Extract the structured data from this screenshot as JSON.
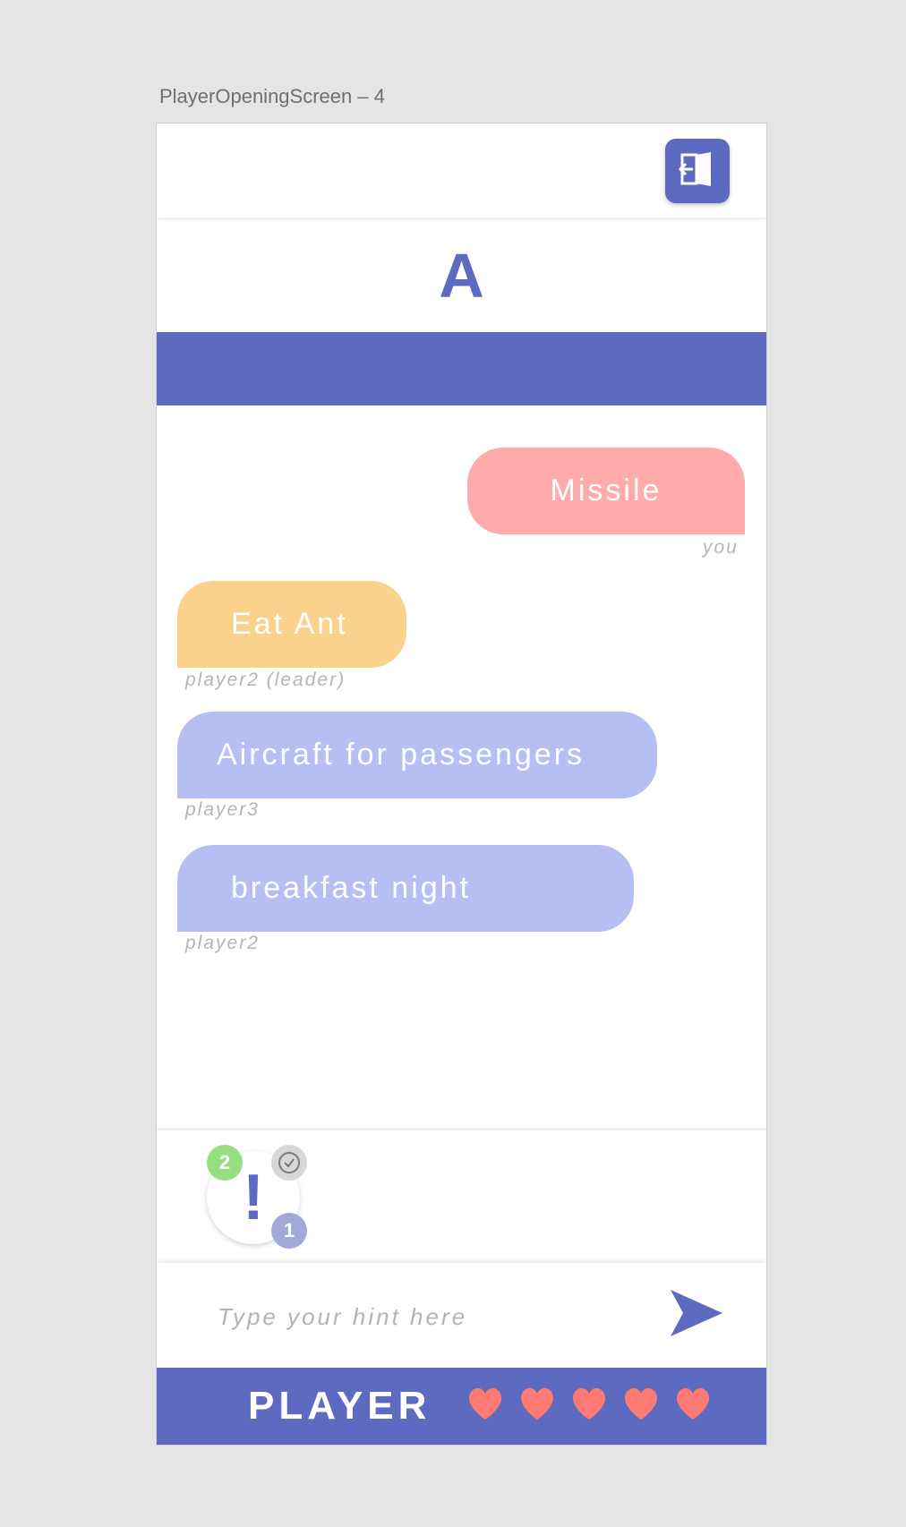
{
  "frame_title": "PlayerOpeningScreen – 4",
  "header": {
    "exit_icon": "exit-door-icon"
  },
  "round": {
    "letter": "A"
  },
  "messages": [
    {
      "text": "Missile",
      "author": "you",
      "color": "#ffabab"
    },
    {
      "text": "Eat Ant",
      "author": "player2 (leader)",
      "color": "#fad28c"
    },
    {
      "text": "Aircraft for passengers",
      "author": "player3",
      "color": "#b6bff4"
    },
    {
      "text": "breakfast night",
      "author": "player2",
      "color": "#b6bff4"
    }
  ],
  "hint_widget": {
    "icon": "exclamation-icon",
    "symbol": "!",
    "badge_top": "2",
    "badge_bottom": "1",
    "timer_icon": "clock-icon"
  },
  "input": {
    "placeholder": "Type your hint here",
    "send_icon": "send-icon"
  },
  "footer": {
    "label": "PLAYER",
    "lives": 5,
    "heart_icon": "heart-icon"
  },
  "colors": {
    "accent": "#5c6bc0",
    "heart": "#ff7a73",
    "badge_green": "#96de7f",
    "badge_purple": "#a2a9d8",
    "badge_gray": "#d7d7d7"
  }
}
